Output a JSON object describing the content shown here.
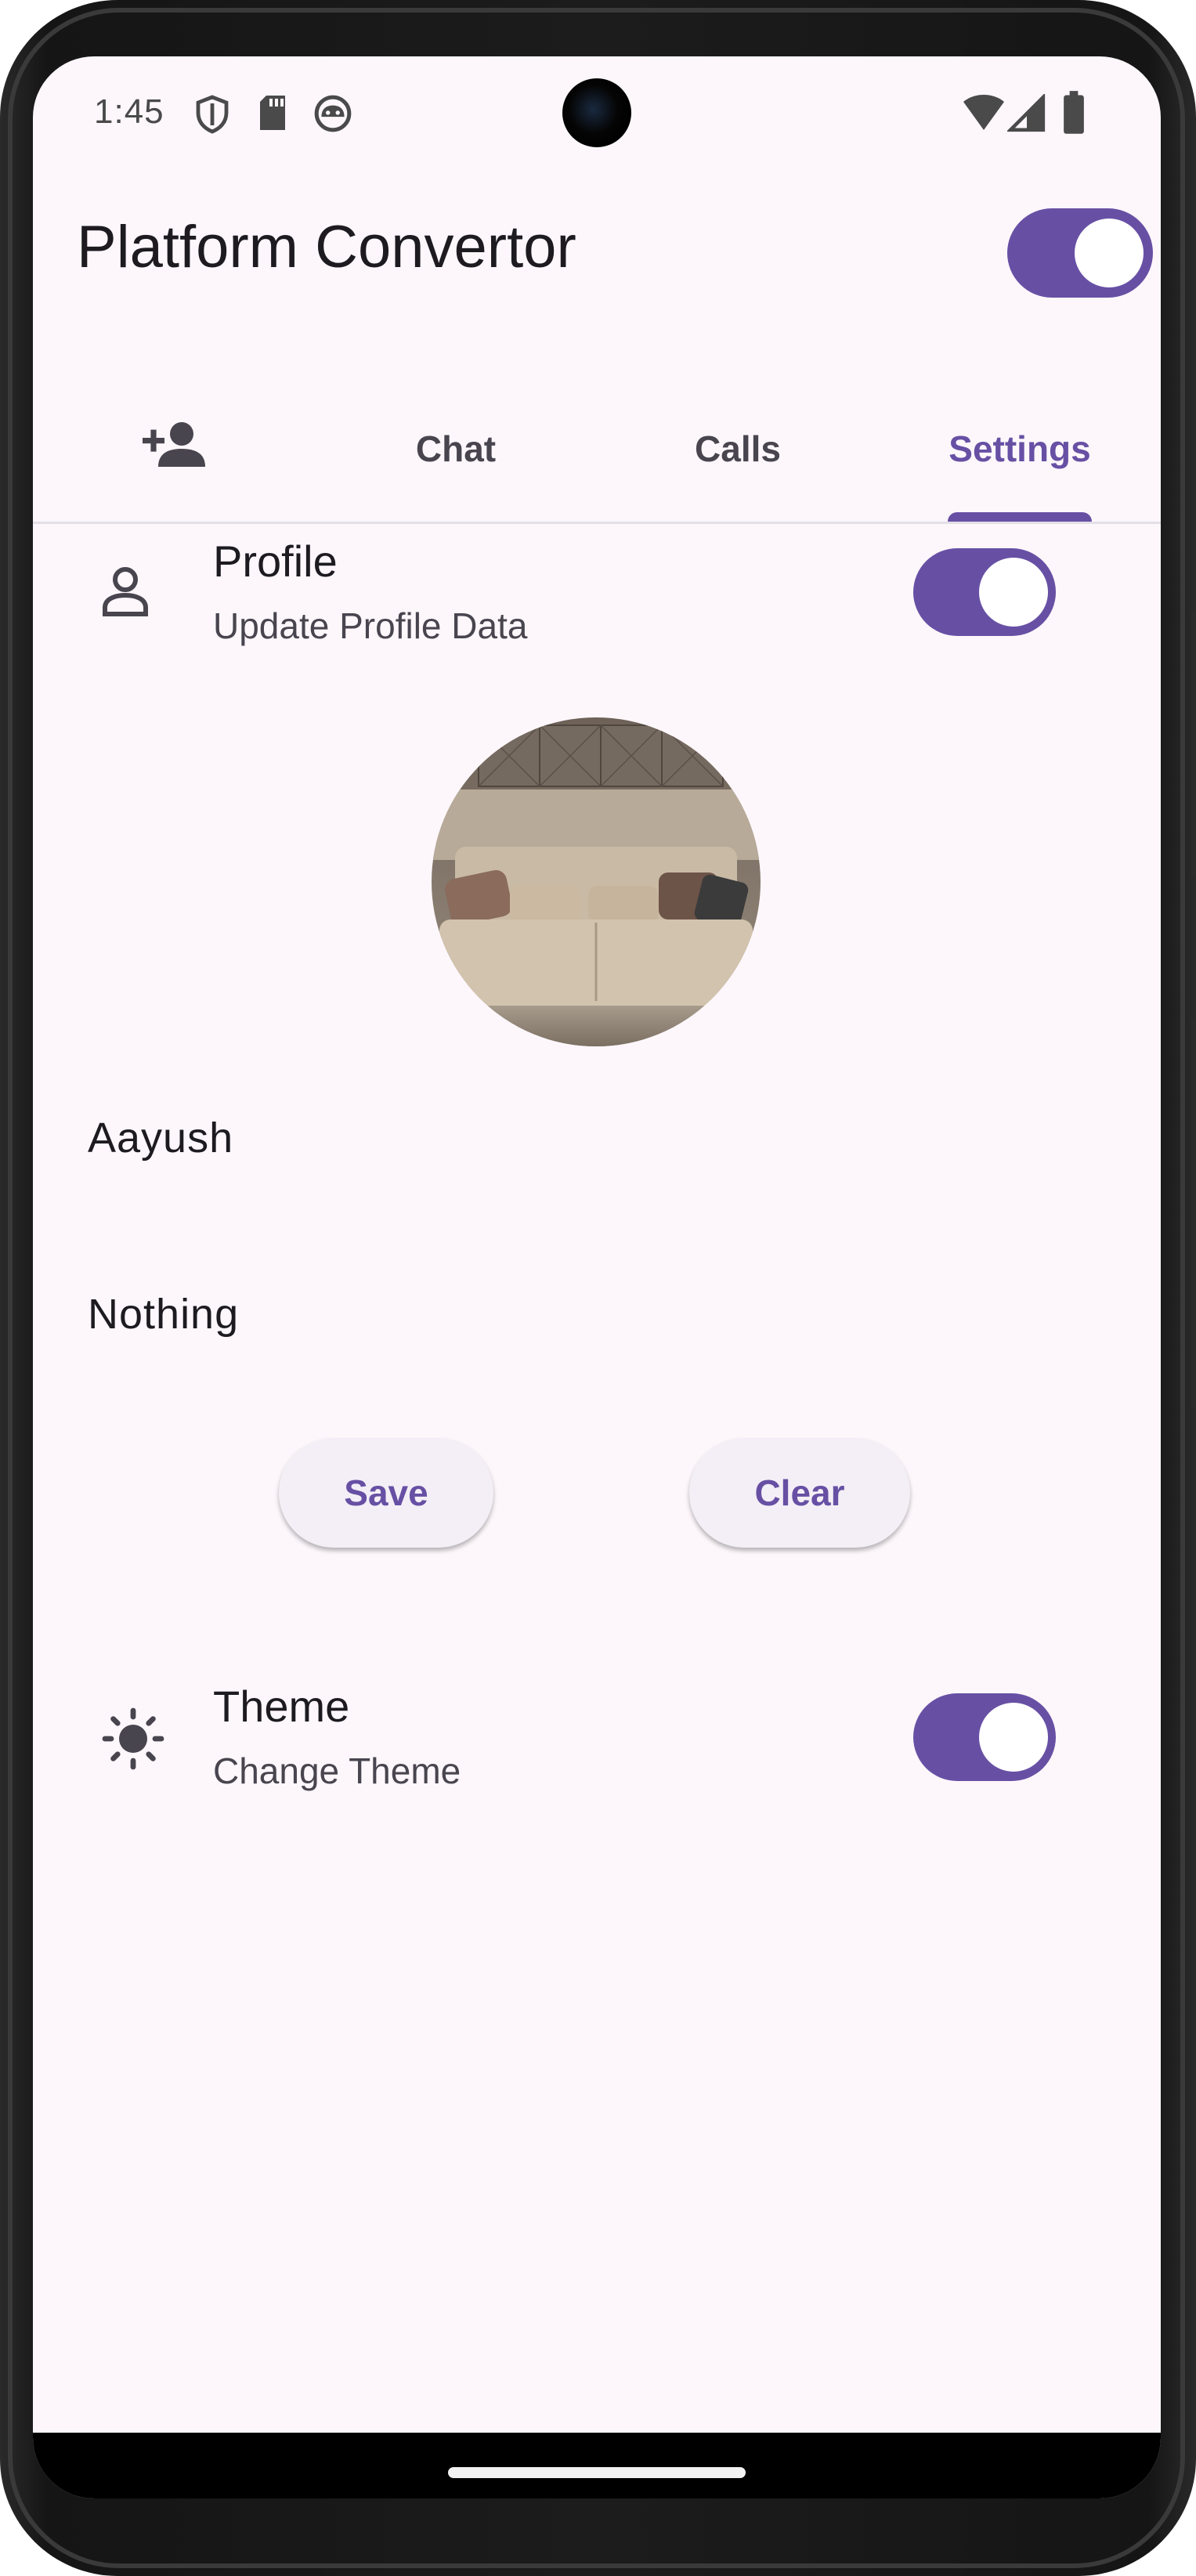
{
  "status_bar": {
    "time": "1:45",
    "icons": [
      "shield-icon",
      "sd-card-icon",
      "android-face-icon",
      "wifi-icon",
      "cell-signal-icon",
      "battery-icon"
    ]
  },
  "app_bar": {
    "title": "Platform Convertor",
    "switch_on": true
  },
  "tabs": [
    {
      "icon": "person-add-icon",
      "label": ""
    },
    {
      "label": "Chat"
    },
    {
      "label": "Calls"
    },
    {
      "label": "Settings",
      "active": true
    }
  ],
  "profile_section": {
    "icon": "person-outline-icon",
    "title": "Profile",
    "subtitle": "Update Profile Data",
    "switch_on": true,
    "avatar": "sofa-photo",
    "name_value": "Aayush",
    "bio_value": "Nothing",
    "save_label": "Save",
    "clear_label": "Clear"
  },
  "theme_section": {
    "icon": "sun-icon",
    "title": "Theme",
    "subtitle": "Change Theme",
    "switch_on": true
  },
  "colors": {
    "primary": "#6750a4",
    "background": "#fdf7fb",
    "on_surface": "#1d1b20",
    "on_surface_variant": "#49454f"
  }
}
